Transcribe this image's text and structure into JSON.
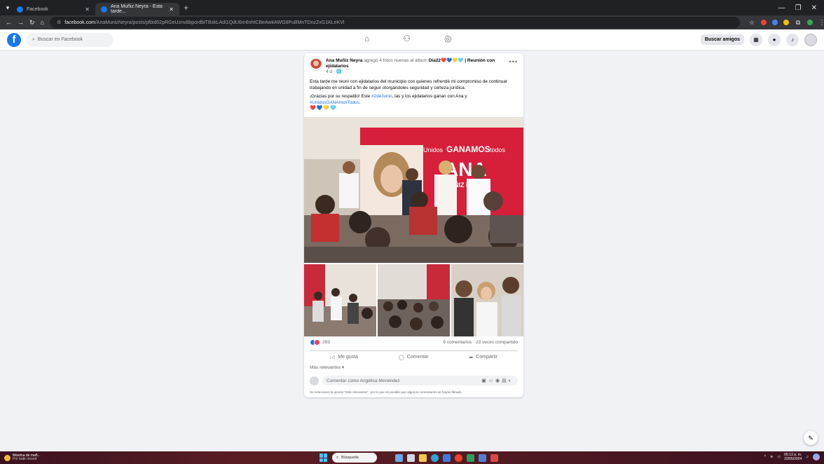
{
  "browser": {
    "tabs": [
      {
        "label": "Facebook",
        "active": false
      },
      {
        "label": "Ana Muñiz Neyra - Esta tarde...",
        "active": true
      }
    ],
    "new_tab": "+",
    "url_domain": "facebook.com",
    "url_path": "/AnaMunizNeyra/posts/pfbid02pRGeUznv8bpordbiTBskLAdi1QdU6m6nhtCBeAwkAWG8PuBMnTDnzZxG1KLeKVl"
  },
  "facebook": {
    "logo": "f",
    "search_placeholder": "Buscar en Facebook",
    "find_friends_label": "Buscar amigos"
  },
  "post": {
    "author": "Ana Muñiz Neyra",
    "action_text": "agregó 4 fotos nuevas al álbum",
    "album_title": "Día22❤️💙💛🩵 | Reunión con ejidatarios",
    "time": "4 d · 🌐",
    "paragraph1": "Esta tarde me reuní con ejidatarios del municipio con quienes refrendé mi compromiso de continuar trabajando en unidad a fin de seguir otorgándoles seguridad y certeza jurídica.",
    "paragraph2_start": "¡Gracias por su respaldo! Este ",
    "hashtag1": "#2deJunio",
    "paragraph2_mid": ", las y los ejidatarios ganan con Ana y ",
    "hashtag2": "#UnidosGANAmosTodos",
    "paragraph2_end": ".",
    "hearts": "❤️💙💛🩵",
    "banner_small": "Unidos",
    "banner_big": "GANAMOS",
    "banner_small2": "todos",
    "banner_name": "ANA",
    "banner_sub": "MUÑIZ NEYRA",
    "reaction_count": "293",
    "comments_shares": "9 comentarios · 23 veces compartido",
    "like_label": "Me gusta",
    "comment_label": "Comentar",
    "share_label": "Compartir",
    "sort_label": "Más relevantes ▾",
    "comment_placeholder": "Comentar como Angélica Menéndez",
    "filter_note": "Se seleccionó la opción \"Más relevantes\", por lo que es posible que algunos comentarios se hayan filtrado."
  },
  "taskbar": {
    "weather_title": "Máxima de mañ...",
    "weather_sub": "Por batir récord",
    "search_label": "Búsqueda",
    "time": "05:13 a. m.",
    "date": "22/05/2024"
  },
  "colors": {
    "facebook_blue": "#1877f2",
    "page_bg": "#f0f2f5",
    "hashtag": "#216fdb"
  }
}
